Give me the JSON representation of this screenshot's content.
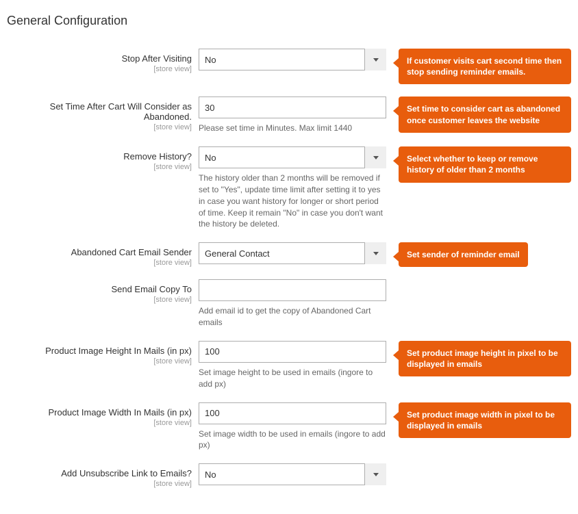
{
  "section_title": "General Configuration",
  "scope_label": "[store view]",
  "fields": {
    "stop_after_visiting": {
      "label": "Stop After Visiting",
      "value": "No",
      "callout": "If customer visits cart second time then stop sending reminder emails."
    },
    "set_time_abandoned": {
      "label": "Set Time After Cart Will Consider as Abandoned.",
      "value": "30",
      "hint": "Please set time in Minutes. Max limit 1440",
      "callout": "Set time to consider cart as abandoned once customer leaves the website"
    },
    "remove_history": {
      "label": "Remove History?",
      "value": "No",
      "hint": "The history older than 2 months will be removed if set to \"Yes\", update time limit after setting it to yes in case you want history for longer or short period of time. Keep it remain \"No\" in case you don't want the history be deleted.",
      "callout": "Select whether to keep or remove history of older than 2 months"
    },
    "email_sender": {
      "label": "Abandoned Cart Email Sender",
      "value": "General Contact",
      "callout": "Set sender of reminder email"
    },
    "email_copy_to": {
      "label": "Send Email Copy To",
      "value": "",
      "hint": "Add email id to get the copy of Abandoned Cart emails"
    },
    "image_height": {
      "label": "Product Image Height In Mails (in px)",
      "value": "100",
      "hint": "Set image height to be used in emails (ingore to add px)",
      "callout": "Set product image height in pixel to be displayed in emails"
    },
    "image_width": {
      "label": "Product Image Width In Mails (in px)",
      "value": "100",
      "hint": "Set image width to be used in emails (ingore to add px)",
      "callout": "Set product image width in pixel to be displayed in emails"
    },
    "unsubscribe_link": {
      "label": "Add Unsubscribe Link to Emails?",
      "value": "No"
    }
  }
}
